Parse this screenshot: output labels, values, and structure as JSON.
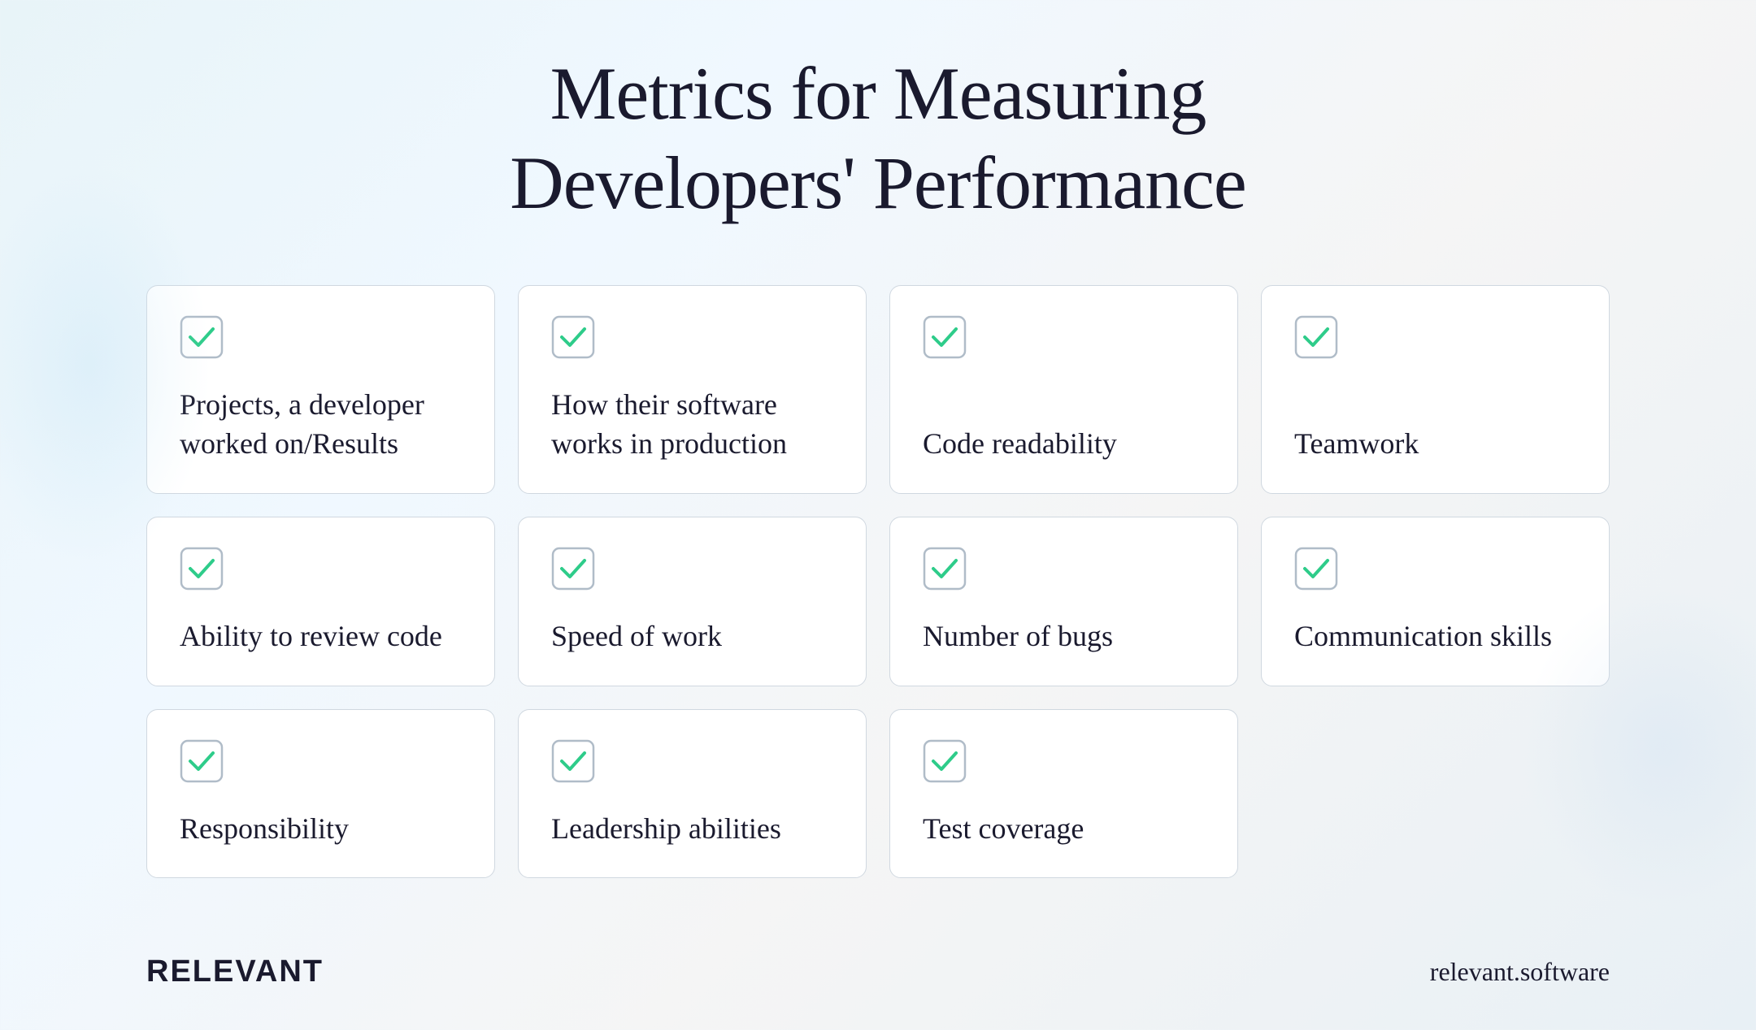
{
  "page": {
    "title_line1": "Metrics for Measuring",
    "title_line2": "Developers' Performance",
    "background_gradient": "linear-gradient(135deg, #e8f4f8 0%, #f0f8ff 30%, #f5f5f5 60%, #e8f0f5 100%)"
  },
  "cards": [
    {
      "id": "projects-results",
      "label": "Projects, a developer worked on/Results",
      "has_checkbox": true,
      "row": 1,
      "col": 1
    },
    {
      "id": "software-production",
      "label": "How their software works in production",
      "has_checkbox": true,
      "row": 1,
      "col": 2
    },
    {
      "id": "code-readability",
      "label": "Code readability",
      "has_checkbox": true,
      "row": 1,
      "col": 3
    },
    {
      "id": "teamwork",
      "label": "Teamwork",
      "has_checkbox": true,
      "row": 1,
      "col": 4
    },
    {
      "id": "ability-to-review-code",
      "label": "Ability to review code",
      "has_checkbox": true,
      "row": 2,
      "col": 1
    },
    {
      "id": "speed-of-work",
      "label": "Speed of work",
      "has_checkbox": true,
      "row": 2,
      "col": 2
    },
    {
      "id": "number-of-bugs",
      "label": "Number of bugs",
      "has_checkbox": true,
      "row": 2,
      "col": 3
    },
    {
      "id": "communication-skills",
      "label": "Communication skills",
      "has_checkbox": true,
      "row": 2,
      "col": 4
    },
    {
      "id": "responsibility",
      "label": "Responsibility",
      "has_checkbox": true,
      "row": 3,
      "col": 1
    },
    {
      "id": "leadership-abilities",
      "label": "Leadership abilities",
      "has_checkbox": true,
      "row": 3,
      "col": 2
    },
    {
      "id": "test-coverage",
      "label": "Test coverage",
      "has_checkbox": true,
      "row": 3,
      "col": 3
    }
  ],
  "footer": {
    "brand": "RELEVANT",
    "website": "relevant.software"
  },
  "checkbox": {
    "color": "#2ecc8a",
    "border_color": "#b0bcc8"
  }
}
